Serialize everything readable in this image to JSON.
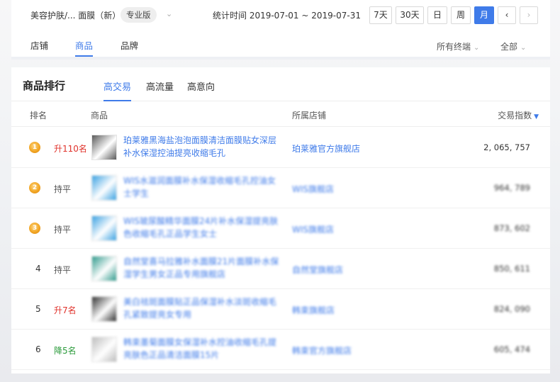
{
  "header": {
    "category": "美容护肤/... 面膜（新）",
    "edition": "专业版",
    "stat_time": "统计时间 2019-07-01 ~ 2019-07-31",
    "period_buttons": [
      "7天",
      "30天",
      "日",
      "周",
      "月"
    ],
    "active_period": "月"
  },
  "nav": {
    "tabs": [
      "店铺",
      "商品",
      "品牌"
    ],
    "active_tab": "商品",
    "filters": [
      "所有终端",
      "全部"
    ]
  },
  "ranking": {
    "title": "商品排行",
    "subtabs": [
      "高交易",
      "高流量",
      "高意向"
    ],
    "active_subtab": "高交易",
    "columns": [
      "排名",
      "商品",
      "所属店铺",
      "交易指数"
    ],
    "rows": [
      {
        "rank": "1",
        "medal": true,
        "trend": "升110名",
        "trend_dir": "up",
        "product": "珀莱雅黑海盐泡泡面膜清洁面膜贴女深层补水保湿控油提亮收缩毛孔",
        "shop": "珀莱雅官方旗舰店",
        "index": "2, 065, 757",
        "blurred": false,
        "thumb_color": "#5a5a5a"
      },
      {
        "rank": "2",
        "medal": true,
        "trend": "持平",
        "trend_dir": "flat",
        "product": "WIS水滋润面膜补水保湿收缩毛孔控油女士学生",
        "shop": "WIS旗舰店",
        "index": "964, 789",
        "blurred": true,
        "thumb_color": "#3aa1e2"
      },
      {
        "rank": "3",
        "medal": true,
        "trend": "持平",
        "trend_dir": "flat",
        "product": "WIS玻尿酸精华面膜24片补水保湿提亮肤色收缩毛孔正品学生女士",
        "shop": "WIS旗舰店",
        "index": "873, 602",
        "blurred": true,
        "thumb_color": "#3aa1e2"
      },
      {
        "rank": "4",
        "medal": false,
        "trend": "持平",
        "trend_dir": "flat",
        "product": "自然堂喜马拉雅补水面膜21片面膜补水保湿学生男女正品专用旗舰店",
        "shop": "自然堂旗舰店",
        "index": "850, 611",
        "blurred": true,
        "thumb_color": "#2f9a8c"
      },
      {
        "rank": "5",
        "medal": false,
        "trend": "升7名",
        "trend_dir": "up",
        "product": "美白祛斑面膜贴正品保湿补水淡斑收缩毛孔紧致提亮女专用",
        "shop": "韩束旗舰店",
        "index": "824, 090",
        "blurred": true,
        "thumb_color": "#333333"
      },
      {
        "rank": "6",
        "medal": false,
        "trend": "降5名",
        "trend_dir": "down",
        "product": "韩束墨菊面膜女保湿补水控油收缩毛孔提亮肤色正品清洁面膜15片",
        "shop": "韩束官方旗舰店",
        "index": "605, 474",
        "blurred": true,
        "thumb_color": "#bdbdbd"
      }
    ]
  }
}
